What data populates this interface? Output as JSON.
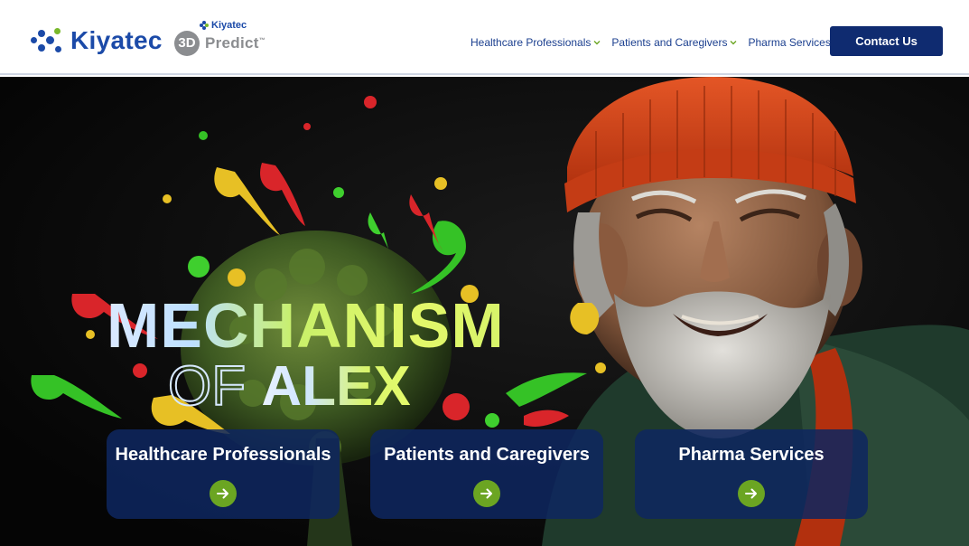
{
  "header": {
    "brand": "Kiyatec",
    "predict_logo": {
      "badge": "3D",
      "brand": "Kiyatec",
      "word": "Predict",
      "trademark": "™"
    },
    "nav": [
      {
        "label": "Healthcare Professionals",
        "icon": "chevron-down-icon"
      },
      {
        "label": "Patients and Caregivers",
        "icon": "chevron-down-icon"
      },
      {
        "label": "Pharma Services",
        "icon": "chevron-down-icon"
      }
    ],
    "contact_label": "Contact Us"
  },
  "hero": {
    "title_line1": "MECHANISM",
    "title_of": "OF",
    "title_alex": "ALEX"
  },
  "cards": [
    {
      "label": "Healthcare Professionals",
      "icon": "arrow-right-icon"
    },
    {
      "label": "Patients and Caregivers",
      "icon": "arrow-right-icon"
    },
    {
      "label": "Pharma Services",
      "icon": "arrow-right-icon"
    }
  ],
  "colors": {
    "brand_blue": "#1b4aa8",
    "nav_text": "#1b3f8f",
    "contact_button": "#0f2b70",
    "card_bg": "#0e2660",
    "arrow_green": "#6ba522",
    "predict_gray": "#8b8d90",
    "hat_orange": "#d8431c"
  }
}
